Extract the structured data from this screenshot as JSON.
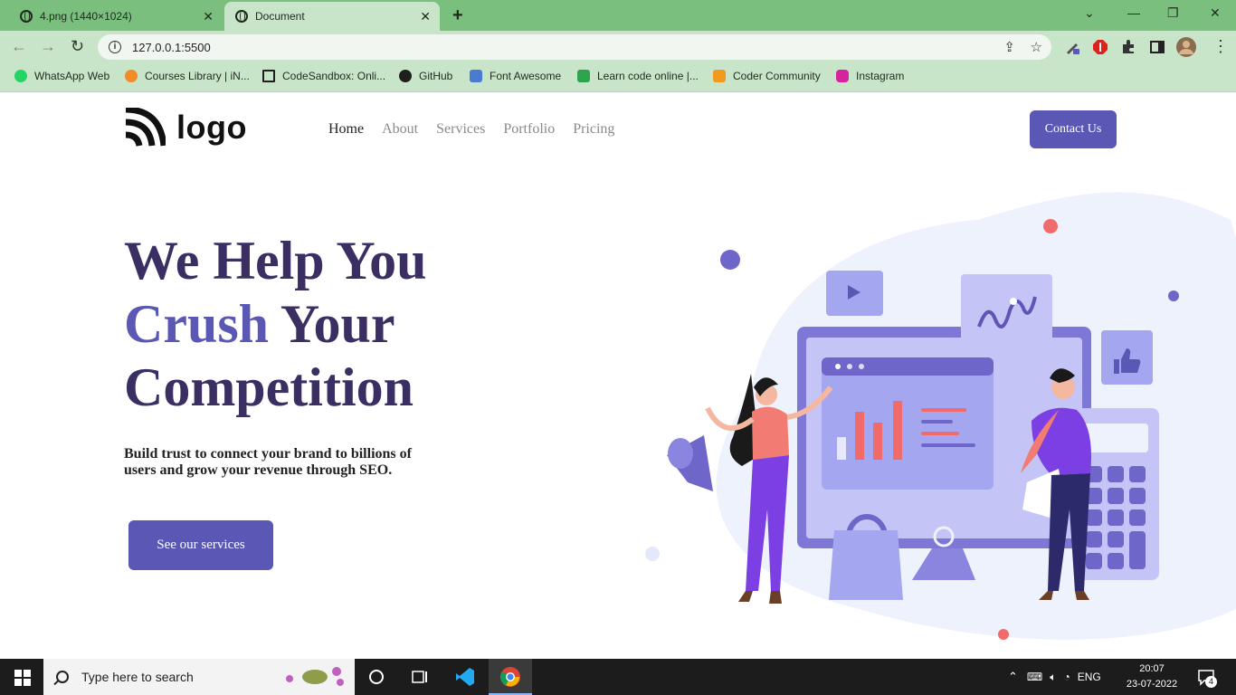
{
  "browser": {
    "tabs": [
      {
        "title": "4.png (1440×1024)",
        "active": false
      },
      {
        "title": "Document",
        "active": true
      }
    ],
    "new_tab": "+",
    "url": "127.0.0.1:5500",
    "bookmarks": [
      {
        "label": "WhatsApp Web",
        "icon_color": "#25d366"
      },
      {
        "label": "Courses Library | iN...",
        "icon_color": "#f28c28"
      },
      {
        "label": "CodeSandbox: Onli...",
        "icon_color": "#1f1f1f"
      },
      {
        "label": "GitHub",
        "icon_color": "#1f1f1f"
      },
      {
        "label": "Font Awesome",
        "icon_color": "#4a7bd0"
      },
      {
        "label": "Learn code online |...",
        "icon_color": "#2ea44f"
      },
      {
        "label": "Coder Community",
        "icon_color": "#f29a1e"
      },
      {
        "label": "Instagram",
        "icon_color": "#d6249f"
      }
    ]
  },
  "site": {
    "logo_text": "logo",
    "nav": [
      "Home",
      "About",
      "Services",
      "Portfolio",
      "Pricing"
    ],
    "contact_label": "Contact Us",
    "hero": {
      "line1": "We Help You",
      "line2_accent": "Crush",
      "line2_rest": " Your",
      "line3": "Competition",
      "subtitle": "Build trust to connect your brand to billions of users and grow your revenue through SEO.",
      "cta_label": "See our services"
    },
    "colors": {
      "primary": "#5b57b4",
      "heading": "#3a2e62",
      "blob": "#eef2fd"
    }
  },
  "taskbar": {
    "search_placeholder": "Type here to search",
    "language": "ENG",
    "time": "20:07",
    "date": "23-07-2022",
    "notification_count": "4"
  }
}
